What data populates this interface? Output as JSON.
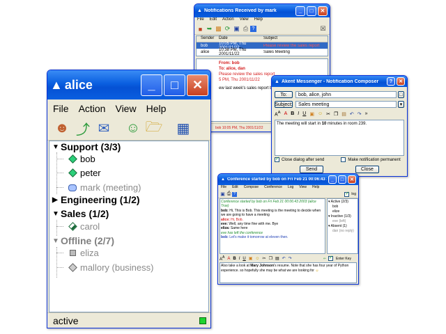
{
  "notifications": {
    "title": "Notifications Received by mark",
    "menu": [
      "File",
      "Edit",
      "Action",
      "View",
      "Help"
    ],
    "columns": [
      "Sender",
      "Date",
      "Subject"
    ],
    "rows": [
      {
        "sender": "bob",
        "date": "10:05 PM, Thu 2001/11/22",
        "subject": "Please review the sales report"
      },
      {
        "sender": "alice",
        "date": "10:38 PM, Thu 2001/11/22",
        "subject": "Sales Meeting"
      }
    ],
    "preview_from": "From: bob",
    "preview_to": "To: alice, dan",
    "preview_subject": "Please review the sales report",
    "preview_date": "5 PM, Thu 2001/11/22",
    "preview_body": "ew last week's sales report before to",
    "status_sender": "bob 10:05 PM, Thu 2001/11/22"
  },
  "composer": {
    "title": "Akent Messenger - Notification Composer",
    "to_label": "To:",
    "to_value": "bob, alice, john",
    "subject_label": "Subject:",
    "subject_value": "Sales meeting",
    "message_pre": "The meeting will start in ",
    "message_bold": "10",
    "message_post": " minutes in room 239.",
    "close_after_send": "Close dialog after send",
    "make_permanent": "Make notification permanent",
    "send_label": "Send",
    "close_label": "Close"
  },
  "conference": {
    "title": "Conference started by bob on Fri Feb 21 00:06:43 2003",
    "menu": [
      "File",
      "Edit",
      "Compose",
      "Conference",
      "Log",
      "View",
      "Help"
    ],
    "log_label": "log",
    "chat": [
      {
        "speaker": "",
        "text": "Conference started by bob on Fri Feb 21 00:06:43 2003 (alice True)",
        "style": "green"
      },
      {
        "speaker": "bob:",
        "text": " Hi, This is Bob. This meeting is the meeting to decide when we are going to have a meeting",
        "style": "normal"
      },
      {
        "speaker": "alice:",
        "text": " Hi, Bob.",
        "style": "red"
      },
      {
        "speaker": "eve:",
        "text": " Well, any time fine with me. Bye",
        "style": "normal"
      },
      {
        "speaker": "eliza:",
        "text": " Same here",
        "style": "normal"
      },
      {
        "speaker": "",
        "text": "eve has left the conference",
        "style": "green"
      },
      {
        "speaker": "bob:",
        "text": " Let's make it tomorrow at eleven then.",
        "style": "blue"
      }
    ],
    "roster": {
      "active": "Active (2/3)",
      "active_members": [
        "bob",
        "elize"
      ],
      "inactive": "Inactive (1/3)",
      "inactive_members": [
        "eve (left)"
      ],
      "absent": "Absent (1)",
      "absent_members": [
        "dan (no reply)"
      ]
    },
    "enter_key": "Enter Key",
    "entry_pre": "Also take a look at ",
    "entry_bold": "Mary Johnson",
    "entry_post": "'s resume. Note that she has four year of Python experience. so hopefully she may be what we are looking for"
  },
  "alice": {
    "title": "alice",
    "menu": [
      "File",
      "Action",
      "View",
      "Help"
    ],
    "groups": {
      "support": "Support (3/3)",
      "engineering": "Engineering (1/2)",
      "sales": "Sales (1/2)",
      "offline": "Offline (2/7)"
    },
    "contacts": {
      "bob": "bob",
      "peter": "peter",
      "mark": "mark (meeting)",
      "carol": "carol",
      "eliza": "eliza",
      "mallory": "mallory (business)"
    },
    "status": "active"
  },
  "colors": {
    "titlebar": "#0a5fe0",
    "online": "#1fd32f",
    "selection": "#316ac5"
  }
}
